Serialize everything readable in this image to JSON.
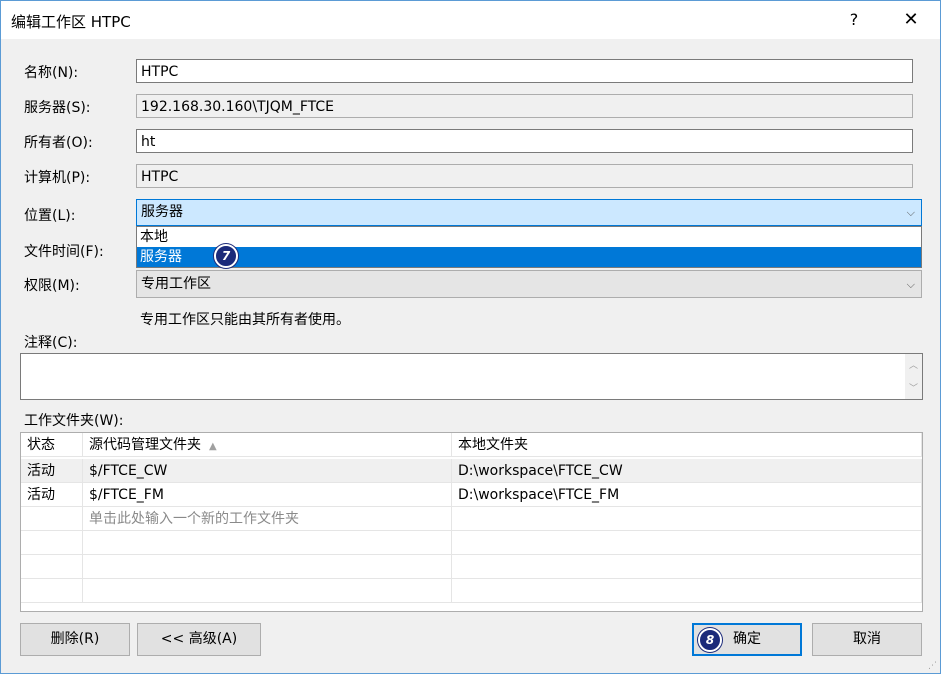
{
  "window": {
    "title": "编辑工作区 HTPC",
    "help_label": "?",
    "close_label": "✕"
  },
  "form": {
    "name_label": "名称(N):",
    "name_value": "HTPC",
    "server_label": "服务器(S):",
    "server_value": "192.168.30.160\\TJQM_FTCE",
    "owner_label": "所有者(O):",
    "owner_value": "ht",
    "computer_label": "计算机(P):",
    "computer_value": "HTPC",
    "location_label": "位置(L):",
    "location_value": "服务器",
    "location_options": [
      "本地",
      "服务器"
    ],
    "file_time_label": "文件时间(F):",
    "permission_label": "权限(M):",
    "permission_value": "专用工作区",
    "permission_note": "专用工作区只能由其所有者使用。",
    "comment_label": "注释(C):"
  },
  "badges": {
    "step7": "7",
    "step8": "8"
  },
  "folders": {
    "label": "工作文件夹(W):",
    "columns": [
      "状态",
      "源代码管理文件夹",
      "本地文件夹"
    ],
    "rows": [
      [
        "活动",
        "$/FTCE_CW",
        "D:\\workspace\\FTCE_CW"
      ],
      [
        "活动",
        "$/FTCE_FM",
        "D:\\workspace\\FTCE_FM"
      ]
    ],
    "new_row_hint": "单击此处输入一个新的工作文件夹"
  },
  "buttons": {
    "delete": "删除(R)",
    "advanced": "<< 高级(A)",
    "ok": "确定",
    "cancel": "取消"
  }
}
